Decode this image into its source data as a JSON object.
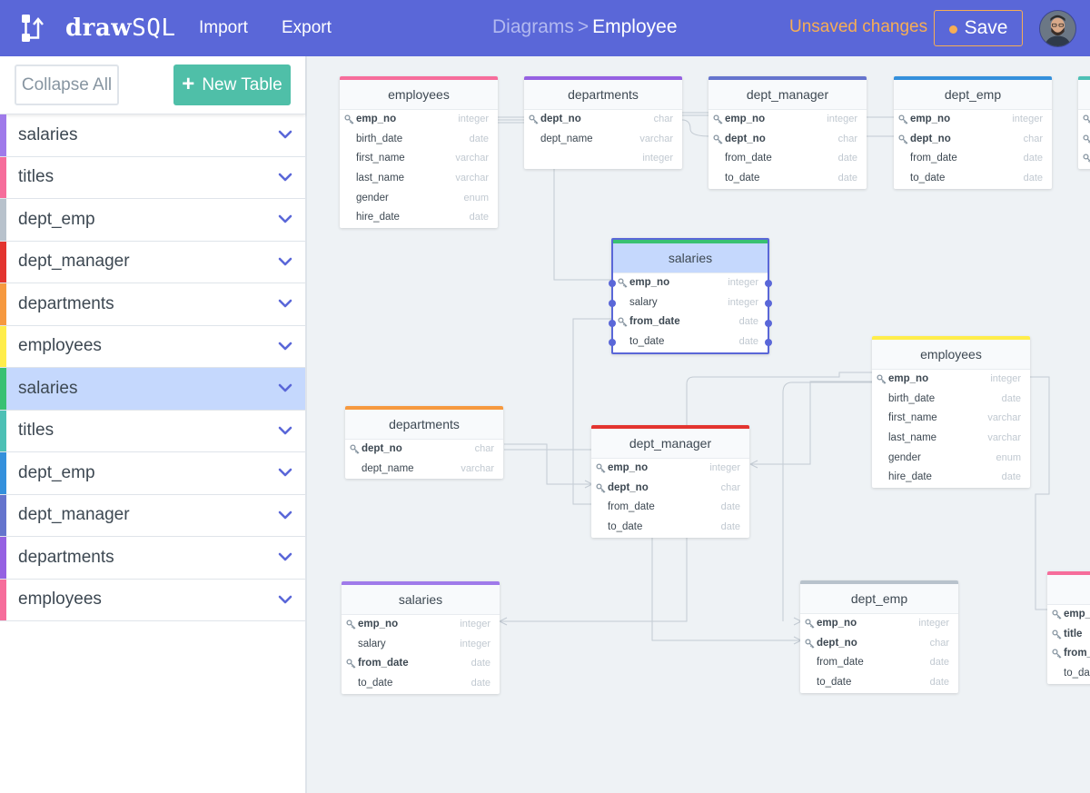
{
  "header": {
    "brand_bold": "draw",
    "brand_light": "SQL",
    "nav": [
      "Import",
      "Export"
    ],
    "breadcrumb": {
      "parent": "Diagrams",
      "separator": ">",
      "current": "Employee"
    },
    "status": "Unsaved changes",
    "save_label": "Save",
    "colors": {
      "bar": "#5a67d8",
      "status": "#f6ad55"
    }
  },
  "sidebar": {
    "collapse_label": "Collapse All",
    "new_table_label": "New Table",
    "items": [
      {
        "label": "salaries",
        "color": "#9f7aea"
      },
      {
        "label": "titles",
        "color": "#f66d9b"
      },
      {
        "label": "dept_emp",
        "color": "#b8c2cc"
      },
      {
        "label": "dept_manager",
        "color": "#e3342f"
      },
      {
        "label": "departments",
        "color": "#f6993f"
      },
      {
        "label": "employees",
        "color": "#ffed4a"
      },
      {
        "label": "salaries",
        "color": "#38c172",
        "active": true
      },
      {
        "label": "titles",
        "color": "#4dc0b5"
      },
      {
        "label": "dept_emp",
        "color": "#3490dc"
      },
      {
        "label": "dept_manager",
        "color": "#6574cd"
      },
      {
        "label": "departments",
        "color": "#9561e2"
      },
      {
        "label": "employees",
        "color": "#f66d9b"
      }
    ]
  },
  "tables": [
    {
      "id": "t1",
      "name": "employees",
      "color": "#f66d9b",
      "rows": [
        [
          "emp_no",
          "integer",
          true
        ],
        [
          "birth_date",
          "date",
          false
        ],
        [
          "first_name",
          "varchar",
          false
        ],
        [
          "last_name",
          "varchar",
          false
        ],
        [
          "gender",
          "enum",
          false
        ],
        [
          "hire_date",
          "date",
          false
        ]
      ]
    },
    {
      "id": "t2",
      "name": "departments",
      "color": "#9561e2",
      "rows": [
        [
          "dept_no",
          "char",
          true
        ],
        [
          "dept_name",
          "varchar",
          false
        ],
        [
          "",
          "integer",
          false
        ]
      ]
    },
    {
      "id": "t3",
      "name": "dept_manager",
      "color": "#6574cd",
      "rows": [
        [
          "emp_no",
          "integer",
          true
        ],
        [
          "dept_no",
          "char",
          true
        ],
        [
          "from_date",
          "date",
          false
        ],
        [
          "to_date",
          "date",
          false
        ]
      ]
    },
    {
      "id": "t4",
      "name": "dept_emp",
      "color": "#3490dc",
      "rows": [
        [
          "emp_no",
          "integer",
          true
        ],
        [
          "dept_no",
          "char",
          true
        ],
        [
          "from_date",
          "date",
          false
        ],
        [
          "to_date",
          "date",
          false
        ]
      ]
    },
    {
      "id": "t5",
      "name": "salaries",
      "color": "#38c172",
      "selected": true,
      "rows": [
        [
          "emp_no",
          "integer",
          true
        ],
        [
          "salary",
          "integer",
          false
        ],
        [
          "from_date",
          "date",
          true
        ],
        [
          "to_date",
          "date",
          false
        ]
      ]
    },
    {
      "id": "t6",
      "name": "employees",
      "color": "#ffed4a",
      "rows": [
        [
          "emp_no",
          "integer",
          true
        ],
        [
          "birth_date",
          "date",
          false
        ],
        [
          "first_name",
          "varchar",
          false
        ],
        [
          "last_name",
          "varchar",
          false
        ],
        [
          "gender",
          "enum",
          false
        ],
        [
          "hire_date",
          "date",
          false
        ]
      ]
    },
    {
      "id": "t7",
      "name": "departments",
      "color": "#f6993f",
      "rows": [
        [
          "dept_no",
          "char",
          true
        ],
        [
          "dept_name",
          "varchar",
          false
        ]
      ]
    },
    {
      "id": "t8",
      "name": "dept_manager",
      "color": "#e3342f",
      "rows": [
        [
          "emp_no",
          "integer",
          true
        ],
        [
          "dept_no",
          "char",
          true
        ],
        [
          "from_date",
          "date",
          false
        ],
        [
          "to_date",
          "date",
          false
        ]
      ]
    },
    {
      "id": "t9",
      "name": "salaries",
      "color": "#9f7aea",
      "rows": [
        [
          "emp_no",
          "integer",
          true
        ],
        [
          "salary",
          "integer",
          false
        ],
        [
          "from_date",
          "date",
          true
        ],
        [
          "to_date",
          "date",
          false
        ]
      ]
    },
    {
      "id": "t10",
      "name": "dept_emp",
      "color": "#b8c2cc",
      "rows": [
        [
          "emp_no",
          "integer",
          true
        ],
        [
          "dept_no",
          "char",
          true
        ],
        [
          "from_date",
          "date",
          false
        ],
        [
          "to_date",
          "date",
          false
        ]
      ]
    },
    {
      "id": "t11",
      "name": "",
      "color": "#4dc0b5",
      "rows": [
        [
          "",
          "",
          true
        ],
        [
          "",
          "",
          true
        ],
        [
          "",
          "",
          true
        ]
      ]
    },
    {
      "id": "t12",
      "name": "",
      "color": "#f66d9b",
      "rows": [
        [
          "emp_",
          "",
          true
        ],
        [
          "title",
          "",
          true
        ],
        [
          "from_",
          "",
          true
        ],
        [
          "to_da",
          "",
          false
        ]
      ]
    }
  ]
}
